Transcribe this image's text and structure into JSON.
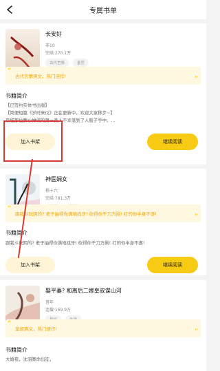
{
  "header": {
    "title": "专属书单"
  },
  "books": [
    {
      "title": "长安好",
      "author": "非10",
      "meta": "完结·270.1万",
      "tags": [
        "古代言情",
        "皇宫"
      ],
      "quote": "古代言情爽文，热门佳作!",
      "section_title": "书籍简介",
      "desc_lines": [
        "【已签约实体书出版】",
        "【简便短篇《岁时来仪》正在更新中，欢迎大家移步~】",
        "京城那位脾小婷弱的第一美人不幸落到了人贩子手中。..."
      ],
      "add_label": "加入书架",
      "read_label": "继续阅读"
    },
    {
      "title": "神医娴女",
      "author": "杨十六",
      "meta": "完结·781.3万",
      "tags": [
        "种田",
        "娴女"
      ],
      "quote": "跟我斗玩阴的? 老子抽得你满地找牙! 砍得你千刀万剐! 打的你半身不遂!",
      "section_title": "书籍简介",
      "desc_lines": [
        "跟我斗玩阴的? 老子抽得你满地找牙! 砍得你千刀万剐! 打的你半身不遂!"
      ],
      "add_label": "加入书架",
      "read_label": "继续阅读"
    },
    {
      "title": "娶平妻? 和离后二嫁皇叔谋山河",
      "author": "昔年",
      "meta": "连载·169.9万",
      "tags": [
        "皇权",
        "女强"
      ],
      "quote": "皇叔爽文，热门佳作!",
      "section_title": "书籍简介",
      "desc_lines": [
        "大婚夜，沈羽寨命出征，"
      ],
      "add_label": "",
      "read_label": ""
    }
  ]
}
